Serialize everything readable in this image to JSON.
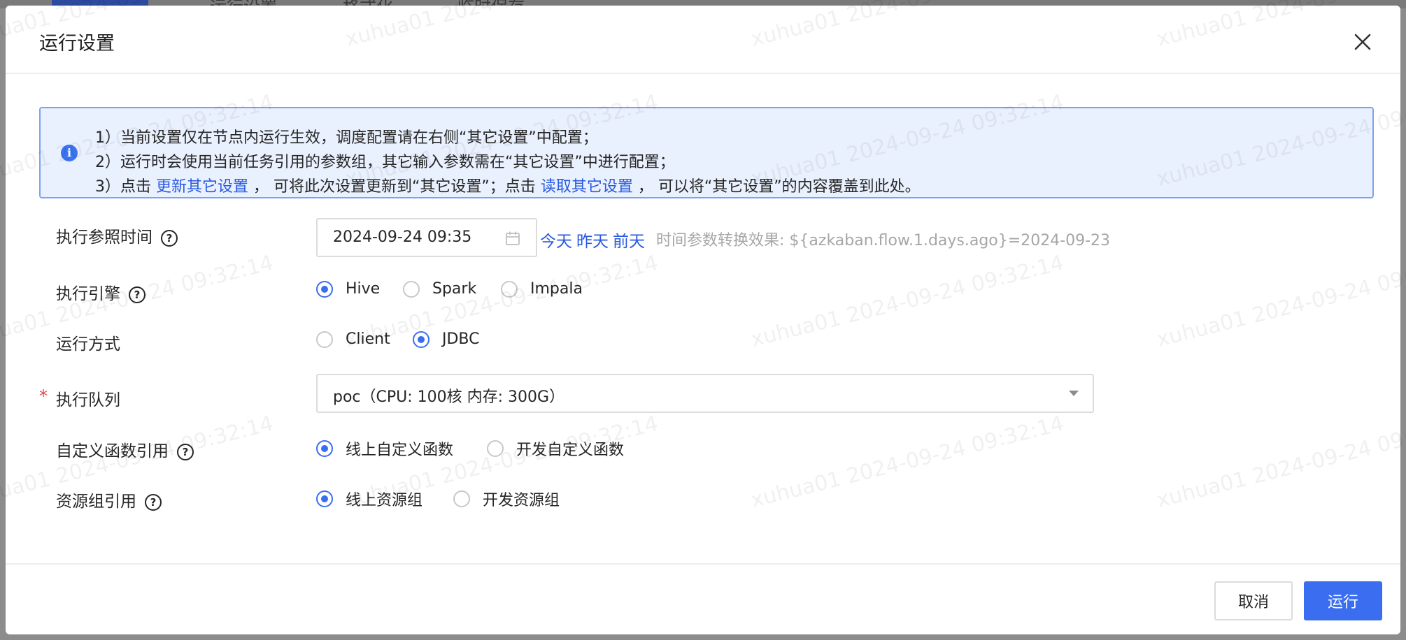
{
  "background": {
    "toolbar": {
      "run": "运行",
      "settings": "运行设置",
      "format": "格式化",
      "save": "临时保存"
    }
  },
  "dialog": {
    "title": "运行设置",
    "notice": {
      "line1": "1）当前设置仅在节点内运行生效，调度配置请在右侧“其它设置”中配置；",
      "line2": "2）运行时会使用当前任务引用的参数组，其它输入参数需在“其它设置”中进行配置；",
      "line3_prefix": "3）点击",
      "line3_link1": "更新其它设置",
      "line3_middle": "， 可将此次设置更新到“其它设置”；点击",
      "line3_link2": "读取其它设置",
      "line3_suffix": "， 可以将“其它设置”的内容覆盖到此处。"
    },
    "form": {
      "ref_time": {
        "label": "执行参照时间",
        "value": "2024-09-24 09:35",
        "quick": [
          "今天",
          "昨天",
          "前天"
        ],
        "preview_label": "时间参数转换效果:",
        "preview_value": "${azkaban.flow.1.days.ago}=2024-09-23"
      },
      "engine": {
        "label": "执行引擎",
        "options": [
          "Hive",
          "Spark",
          "Impala"
        ],
        "selected": "Hive"
      },
      "run_mode": {
        "label": "运行方式",
        "options": [
          "Client",
          "JDBC"
        ],
        "selected": "JDBC"
      },
      "queue": {
        "label": "执行队列",
        "required_mark": "*",
        "value": "poc（CPU: 100核 内存: 300G）"
      },
      "udf_ref": {
        "label": "自定义函数引用",
        "options": [
          "线上自定义函数",
          "开发自定义函数"
        ],
        "selected": "线上自定义函数"
      },
      "resource_ref": {
        "label": "资源组引用",
        "options": [
          "线上资源组",
          "开发资源组"
        ],
        "selected": "线上资源组"
      }
    },
    "footer": {
      "cancel": "取消",
      "run": "运行"
    }
  },
  "watermark": "xuhua01 2024-09-24 09:32:14",
  "colors": {
    "primary": "#3a6df0",
    "link": "#2859e0",
    "notice_bg": "#eaf1fe",
    "notice_border": "#7aa2f4",
    "required": "#e5484d"
  }
}
